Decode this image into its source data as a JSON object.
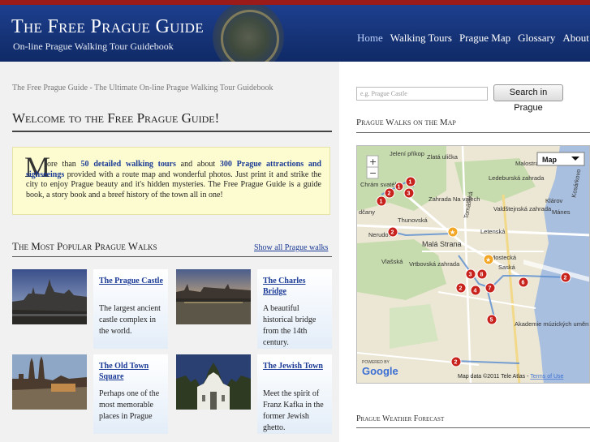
{
  "site": {
    "title": "The Free Prague Guide",
    "subtitle": "On-line Prague Walking Tour Guidebook"
  },
  "nav": [
    "Home",
    "Walking Tours",
    "Prague Map",
    "Glossary",
    "About"
  ],
  "tagline": "The Free Prague Guide - The Ultimate On-line Prague Walking Tour Guidebook",
  "welcome": {
    "heading": "Welcome to the Free Prague Guide!",
    "dropcap": "M",
    "text_1": "ore than ",
    "link_1": "50 detailed walking tours",
    "text_2": " and about ",
    "link_2": "300 Prague attractions and sighseeings",
    "text_3": " provided with a route map and wonderful photos. Just print it and strike the city to enjoy Prague beauty and it's hidden mysteries. The Free Prague Guide is a guide book, a story book and a breef history of the town all in one!"
  },
  "popular": {
    "heading": "The Most Popular Prague Walks",
    "show_all": "Show all Prague walks",
    "cards": [
      {
        "title": "The Prague Castle",
        "desc": "The largest ancient castle complex in the world."
      },
      {
        "title": "The Charles Bridge",
        "desc": "A beautiful historical bridge from the 14th century."
      },
      {
        "title": "The Old Town Square",
        "desc": "Perhaps one of the most memorable places in Prague"
      },
      {
        "title": "The Jewish Town",
        "desc": "Meet the spirit of Franz Kafka in the former Jewish ghetto."
      }
    ]
  },
  "search": {
    "placeholder": "e.g. Prague Castle",
    "button": "Search in Prague"
  },
  "map": {
    "heading": "Prague Walks on the Map",
    "type_select": "Map",
    "zoom_in": "+",
    "zoom_out": "−",
    "attribution": "Map data ©2011 Tele Atlas - ",
    "terms": "Terms of Use",
    "powered_by": "POWERED BY",
    "logo": "Google",
    "labels": [
      "Jelení příkop",
      "Zlatá ulička",
      "Chrám svatého",
      "Ledeburská zahrada",
      "Malostranská",
      "Zahrada Na valech",
      "Valdštejnská zahrada",
      "Klárov",
      "Mánes",
      "dčany",
      "Thunovská",
      "Tomášská",
      "Letenská",
      "Malá Strana",
      "Nerudova",
      "Vlašská",
      "Vrtbovská zahrada",
      "Mostecká",
      "Saská",
      "Akademie múzických umění v Praze",
      "Kosárkovo"
    ],
    "markers": [
      "1",
      "2",
      "1",
      "3",
      "1",
      "2",
      "3",
      "8",
      "2",
      "4",
      "7",
      "6",
      "5",
      "2",
      "2"
    ]
  },
  "weather": {
    "heading": "Prague Weather Forecast"
  }
}
